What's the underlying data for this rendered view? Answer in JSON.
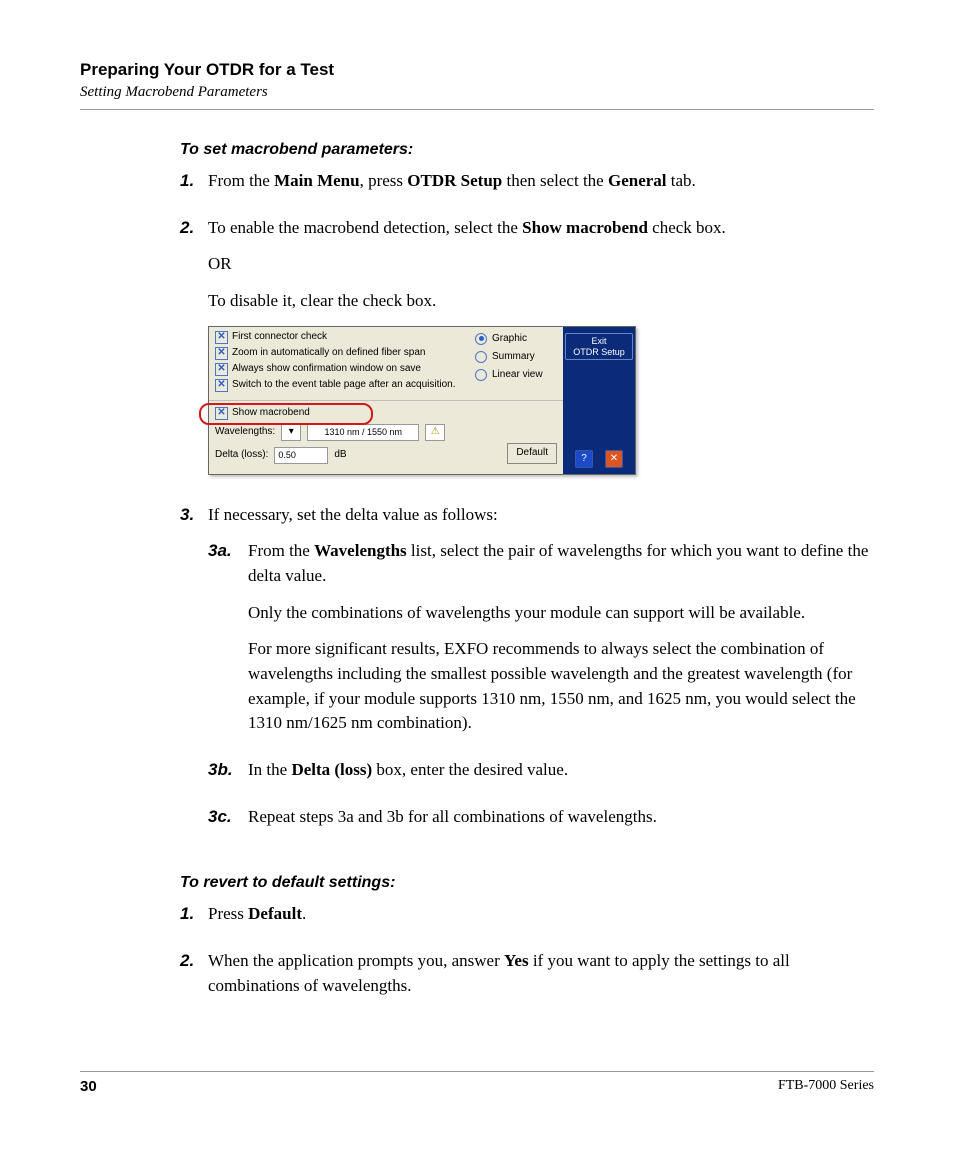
{
  "header": {
    "chapter": "Preparing Your OTDR for a Test",
    "section": "Setting Macrobend Parameters"
  },
  "proc1": {
    "heading": "To set macrobend parameters:",
    "step1": {
      "num": "1.",
      "t1": "From the ",
      "b1": "Main Menu",
      "t2": ", press ",
      "b2": "OTDR Setup",
      "t3": " then select the ",
      "b3": "General",
      "t4": " tab."
    },
    "step2": {
      "num": "2.",
      "t1": "To enable the macrobend detection, select the ",
      "b1": "Show macrobend",
      "t2": " check box.",
      "or": "OR",
      "t3": "To disable it, clear the check box."
    },
    "step3": {
      "num": "3.",
      "t1": "If necessary, set the delta value as follows:",
      "a": {
        "num": "3a.",
        "t1": "From the ",
        "b1": "Wavelengths",
        "t2": " list, select the pair of wavelengths for which you want to define the delta value.",
        "p2": "Only the combinations of wavelengths your module can support will be available.",
        "p3": "For more significant results, EXFO recommends to always select the combination of wavelengths including the smallest possible wavelength and the greatest wavelength (for example, if your module supports 1310 nm, 1550 nm, and 1625 nm, you would select the 1310 nm/1625 nm combination)."
      },
      "b": {
        "num": "3b.",
        "t1": "In the ",
        "b1": "Delta (loss)",
        "t2": " box, enter the desired value."
      },
      "c": {
        "num": "3c.",
        "t1": "Repeat steps 3a and 3b for all combinations of wavelengths."
      }
    }
  },
  "proc2": {
    "heading": "To revert to default settings:",
    "step1": {
      "num": "1.",
      "t1": "Press ",
      "b1": "Default",
      "t2": "."
    },
    "step2": {
      "num": "2.",
      "t1": "When the application prompts you, answer ",
      "b1": "Yes",
      "t2": " if you want to apply the settings to all combinations of wavelengths."
    }
  },
  "mock": {
    "checks": {
      "first_connector": "First connector check",
      "zoom": "Zoom in automatically on defined fiber span",
      "confirm": "Always show confirmation window on save",
      "switch": "Switch to the event table page after an acquisition.",
      "show_macrobend": "Show macrobend"
    },
    "radios": {
      "graphic": "Graphic",
      "summary": "Summary",
      "linear": "Linear view"
    },
    "wavelengths_label": "Wavelengths:",
    "wavelengths_value": "1310 nm / 1550 nm",
    "delta_label": "Delta (loss):",
    "delta_value": "0.50",
    "delta_unit": "dB",
    "default_btn": "Default",
    "exit_line1": "Exit",
    "exit_line2": "OTDR Setup"
  },
  "footer": {
    "page": "30",
    "series": "FTB-7000 Series"
  }
}
